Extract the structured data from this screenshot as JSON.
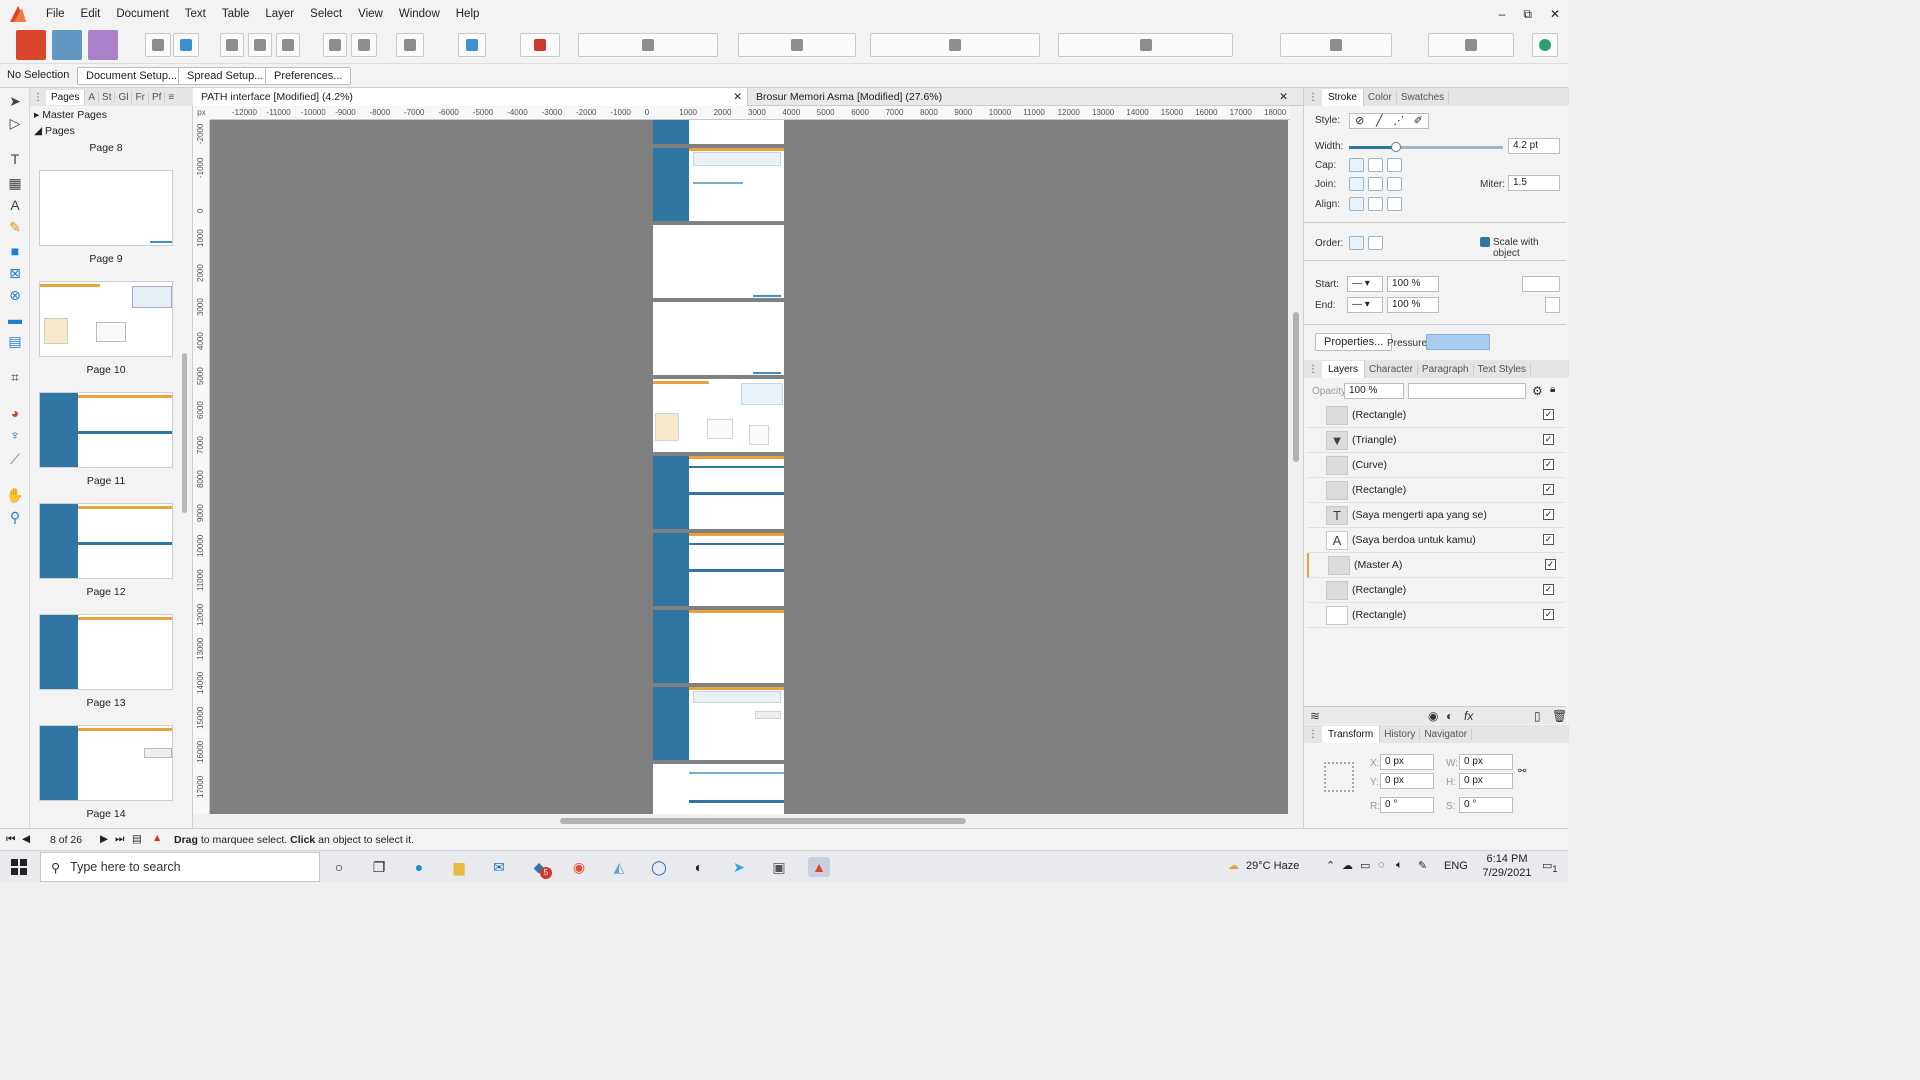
{
  "menubar": {
    "items": [
      "File",
      "Edit",
      "Document",
      "Text",
      "Table",
      "Layer",
      "Select",
      "View",
      "Window",
      "Help"
    ],
    "window_controls": [
      "–",
      "⧉",
      "✕"
    ]
  },
  "context": {
    "selection": "No Selection",
    "buttons": [
      "Document Setup...",
      "Spread Setup...",
      "Preferences..."
    ]
  },
  "pages_panel": {
    "tabs": [
      "Pages",
      "A",
      "St",
      "Gl",
      "Fr",
      "Pf"
    ],
    "master_pages": "Master Pages",
    "pages": "Pages",
    "thumbs": [
      "Page 8",
      "Page 9",
      "Page 10",
      "Page 11",
      "Page 12",
      "Page 13",
      "Page 14"
    ]
  },
  "doc_tabs": [
    "PATH interface [Modified] (4.2%)",
    "Brosur Memori Asma [Modified] (27.6%)"
  ],
  "ruler": {
    "corner": "px",
    "h": [
      "-12000",
      "-11000",
      "-10000",
      "-9000",
      "-8000",
      "-7000",
      "-6000",
      "-5000",
      "-4000",
      "-3000",
      "-2000",
      "-1000",
      "0",
      "1000",
      "2000",
      "3000",
      "4000",
      "5000",
      "6000",
      "7000",
      "8000",
      "9000",
      "10000",
      "11000",
      "12000",
      "13000",
      "14000",
      "15000",
      "16000",
      "17000",
      "18000"
    ],
    "v": [
      "-2000",
      "-1000",
      "0",
      "1000",
      "2000",
      "3000",
      "4000",
      "5000",
      "6000",
      "7000",
      "8000",
      "9000",
      "10000",
      "11000",
      "12000",
      "13000",
      "14000",
      "15000",
      "16000",
      "17000"
    ]
  },
  "stroke_panel": {
    "tabs": [
      "Stroke",
      "Color",
      "Swatches"
    ],
    "style_label": "Style:",
    "width_label": "Width:",
    "width_value": "4.2 pt",
    "cap_label": "Cap:",
    "join_label": "Join:",
    "miter_label": "Miter:",
    "miter_value": "1.5",
    "align_label": "Align:",
    "order_label": "Order:",
    "scale_label": "Scale with object",
    "start_label": "Start:",
    "end_label": "End:",
    "start_pct": "100 %",
    "end_pct": "100 %",
    "properties_btn": "Properties...",
    "pressure_label": "Pressure:"
  },
  "layers_panel": {
    "tabs": [
      "Layers",
      "Character",
      "Paragraph",
      "Text Styles"
    ],
    "opacity_label": "Opacity:",
    "opacity_value": "100 %",
    "rows": [
      {
        "name": "(Rectangle)",
        "icon": ""
      },
      {
        "name": "(Triangle)",
        "icon": "▼"
      },
      {
        "name": "(Curve)",
        "icon": ""
      },
      {
        "name": "(Rectangle)",
        "icon": ""
      },
      {
        "name": "(Saya mengerti apa yang se)",
        "icon": "T"
      },
      {
        "name": "(Saya berdoa untuk kamu)",
        "icon": "A"
      },
      {
        "name": "(Master A)",
        "icon": ""
      },
      {
        "name": "(Rectangle)",
        "icon": ""
      },
      {
        "name": "(Rectangle)",
        "icon": ""
      }
    ]
  },
  "transform_panel": {
    "tabs": [
      "Transform",
      "History",
      "Navigator"
    ],
    "x_label": "X:",
    "x": "0 px",
    "y_label": "Y:",
    "y": "0 px",
    "w_label": "W:",
    "w": "0 px",
    "h_label": "H:",
    "h": "0 px",
    "r_label": "R:",
    "r": "0 °",
    "s_label": "S:",
    "s": "0 °"
  },
  "status": {
    "page": "8 of 26",
    "hint_pre": "Drag",
    "hint_mid": " to marquee select. ",
    "hint_click": "Click",
    "hint_post": " an object to select it."
  },
  "taskbar": {
    "search_placeholder": "Type here to search",
    "weather": "29°C  Haze",
    "lang": "ENG",
    "time": "6:14 PM",
    "date": "7/29/2021",
    "badge": "5",
    "notif": "1"
  },
  "colors": {
    "accent": "#2f76a4",
    "orange": "#e8a33d",
    "canvas": "#808080"
  }
}
